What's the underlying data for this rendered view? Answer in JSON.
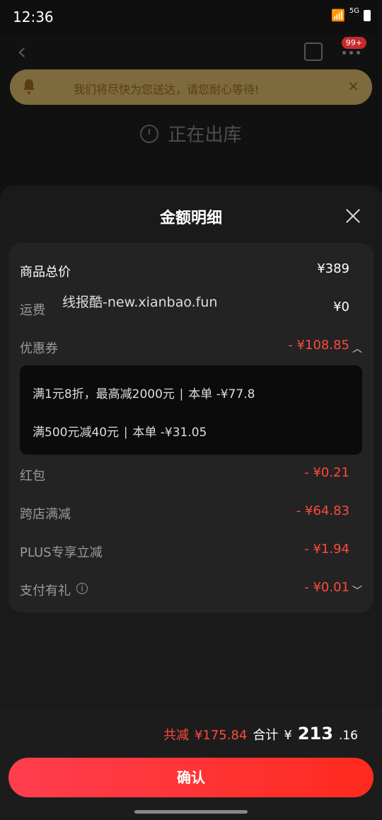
{
  "status_bar": {
    "time": "12:36",
    "network_label": "5G"
  },
  "header": {
    "badge": "99+"
  },
  "notice": {
    "text": "我们将尽快为您送达，请您耐心等待!"
  },
  "order_status": {
    "title": "正在出库"
  },
  "sheet": {
    "title": "金额明细",
    "rows": [
      {
        "label": "商品总价",
        "value": "¥389"
      },
      {
        "label": "运费",
        "value": "¥0"
      },
      {
        "label": "优惠券",
        "value": "- ¥108.85"
      },
      {
        "label": "红包",
        "value": "- ¥0.21"
      },
      {
        "label": "跨店满减",
        "value": "- ¥64.83"
      },
      {
        "label": "PLUS专享立减",
        "value": "- ¥1.94"
      },
      {
        "label": "支付有礼",
        "value": "- ¥0.01"
      }
    ],
    "coupon_details": [
      {
        "text": "满1元8折，最高减2000元 ∣ 本单 -¥77.8"
      },
      {
        "text": "满500元减40元 ∣ 本单 -¥31.05"
      }
    ],
    "watermark": "线报酷-new.xianbao.fun"
  },
  "footer": {
    "total_discount_label": "共减",
    "total_discount_value": "¥175.84",
    "total_label": "合计",
    "total_currency": "¥",
    "total_main": "213",
    "total_decimal": ".16",
    "confirm_label": "确认"
  },
  "icons": {
    "back": "chevron-left-icon",
    "share": "share-icon",
    "more": "more-icon",
    "bell": "bell-icon",
    "close": "close-icon",
    "clock": "clock-icon",
    "info": "info-icon"
  },
  "colors": {
    "accent_red": "#ff4a3a",
    "button_gradient_start": "#ff3e4f",
    "button_gradient_end": "#ff2a1e",
    "notice_bg": "#7d6a3d"
  }
}
